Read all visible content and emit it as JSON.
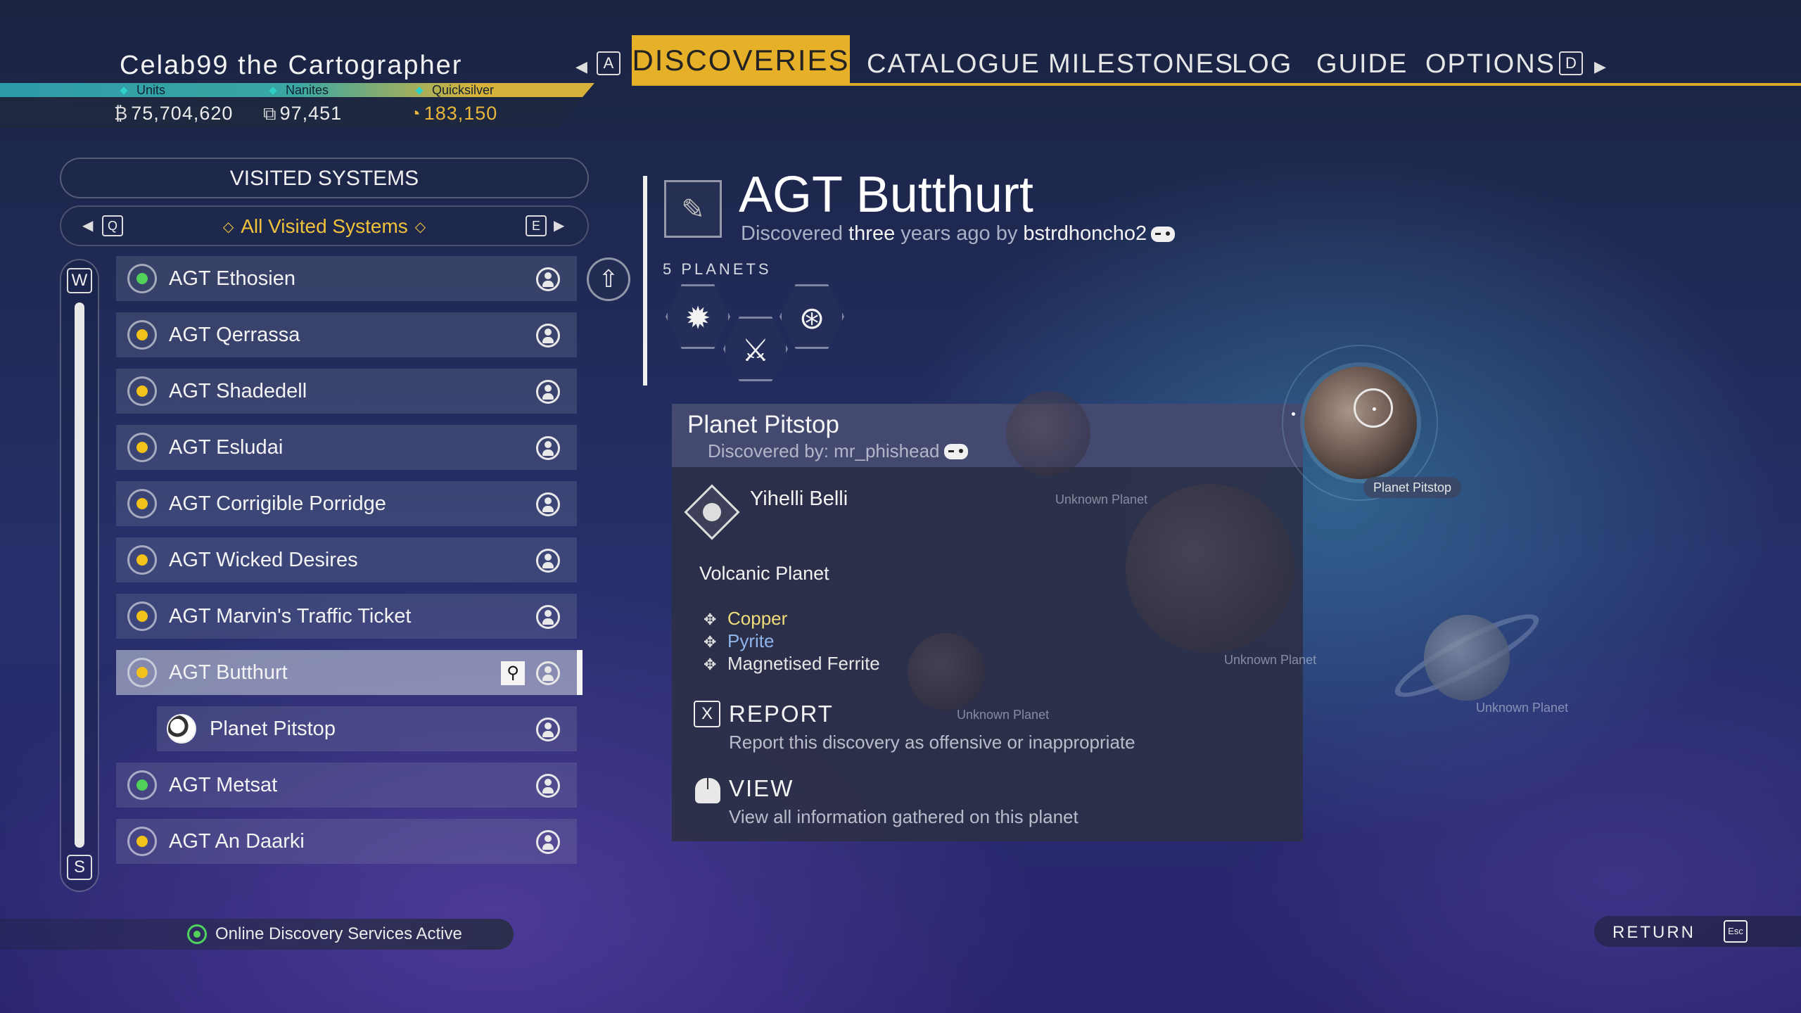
{
  "header": {
    "player_name": "Celab99 the Cartographer",
    "currencies": [
      {
        "label": "Units",
        "value": "75,704,620",
        "icon": "units-icon"
      },
      {
        "label": "Nanites",
        "value": "97,451",
        "icon": "nanites-icon"
      },
      {
        "label": "Quicksilver",
        "value": "183,150",
        "icon": "quicksilver-icon"
      }
    ],
    "nav_prev_key": "A",
    "nav_next_key": "D",
    "tabs": [
      "DISCOVERIES",
      "CATALOGUE",
      "MILESTONES",
      "LOG",
      "GUIDE",
      "OPTIONS"
    ],
    "active_tab": "DISCOVERIES",
    "accent_color": "#e6b028"
  },
  "left_panel": {
    "title": "VISITED SYSTEMS",
    "filter_prev_key": "Q",
    "filter_next_key": "E",
    "filter_label": "All Visited Systems",
    "scroll_up_key": "W",
    "scroll_down_key": "S",
    "systems": [
      {
        "name": "AGT Ethosien",
        "star": "green"
      },
      {
        "name": "AGT Qerrassa",
        "star": "yellow"
      },
      {
        "name": "AGT Shadedell",
        "star": "yellow"
      },
      {
        "name": "AGT Esludai",
        "star": "yellow"
      },
      {
        "name": "AGT Corrigible Porridge",
        "star": "yellow"
      },
      {
        "name": "AGT Wicked Desires",
        "star": "yellow"
      },
      {
        "name": "AGT Marvin's Traffic Ticket",
        "star": "yellow"
      },
      {
        "name": "AGT Butthurt",
        "star": "yellow",
        "selected": true
      },
      {
        "name": "Planet Pitstop",
        "child": true
      },
      {
        "name": "AGT Metsat",
        "star": "green"
      },
      {
        "name": "AGT An Daarki",
        "star": "yellow"
      }
    ],
    "status": "Online Discovery Services Active"
  },
  "system": {
    "title": "AGT Butthurt",
    "discovered_prefix": "Discovered",
    "discovered_when": "three",
    "discovered_mid": "years ago by",
    "discovered_by": "bstrdhoncho2",
    "planet_count_label": "5 PLANETS"
  },
  "detail": {
    "planet_name": "Planet Pitstop",
    "discovered_by": "Discovered by: mr_phishead",
    "region": "Yihelli Belli",
    "planet_type": "Volcanic Planet",
    "resources": [
      {
        "name": "Copper",
        "color": "#f0dc7a"
      },
      {
        "name": "Pyrite",
        "color": "#8fb4ea"
      },
      {
        "name": "Magnetised Ferrite",
        "color": "#e6e6e6"
      }
    ],
    "report_key": "X",
    "report_title": "REPORT",
    "report_desc": "Report this discovery as offensive or inappropriate",
    "view_title": "VIEW",
    "view_desc": "View all information gathered on this planet"
  },
  "map": {
    "selected_label": "Planet Pitstop",
    "unknown_labels": [
      "Unknown Planet",
      "Unknown Planet",
      "Unknown Planet",
      "Unknown Planet"
    ]
  },
  "footer": {
    "return_label": "RETURN",
    "return_key": "Esc"
  }
}
